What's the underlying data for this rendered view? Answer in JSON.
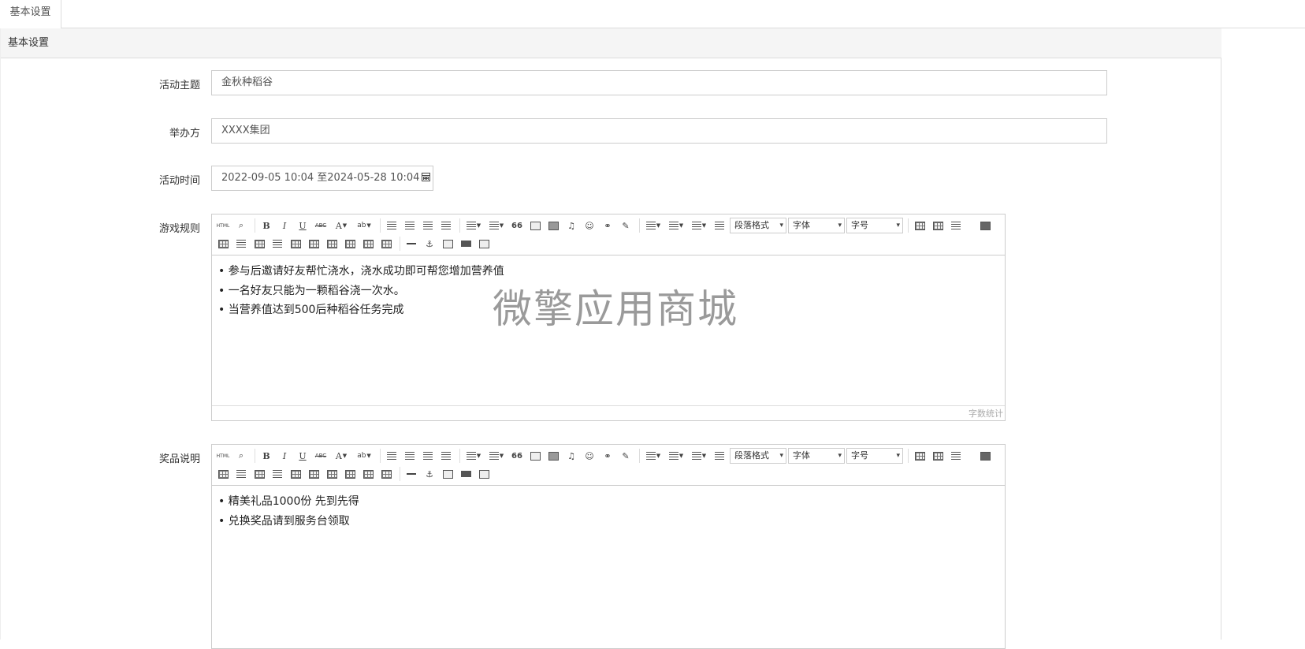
{
  "tab": {
    "label": "基本设置"
  },
  "panel": {
    "title": "基本设置"
  },
  "fields": {
    "theme": {
      "label": "活动主题",
      "value": "金秋种稻谷"
    },
    "organizer": {
      "label": "举办方",
      "value": "XXXX集团"
    },
    "time": {
      "label": "活动时间",
      "value": "2022-09-05 10:04 至2024-05-28 10:04"
    }
  },
  "rules_editor": {
    "label": "游戏规则",
    "lines": [
      "参与后邀请好友帮忙浇水，浇水成功即可帮您增加营养值",
      "一名好友只能为一颗稻谷浇一次水。",
      "当营养值达到500后种稻谷任务完成"
    ],
    "word_count_label": "字数统计"
  },
  "prize_editor": {
    "label": "奖品说明",
    "lines": [
      "精美礼品1000份 先到先得",
      "兑换奖品请到服务台领取"
    ]
  },
  "toolbar": {
    "html_label": "HTML",
    "bold": "B",
    "italic": "I",
    "underline": "U",
    "strike": "ABC",
    "fontcolor": "A",
    "bgcolor": "ab",
    "quote": "66",
    "paragraph_select": "段落格式",
    "font_select": "字体",
    "size_select": "字号"
  },
  "watermark": "微擎应用商城",
  "icons": [
    "search-icon",
    "calendar-icon",
    "image-icon",
    "video-icon",
    "music-icon",
    "emotion-icon",
    "link-icon",
    "eraser-icon",
    "table-icon",
    "print-icon",
    "anchor-icon"
  ]
}
